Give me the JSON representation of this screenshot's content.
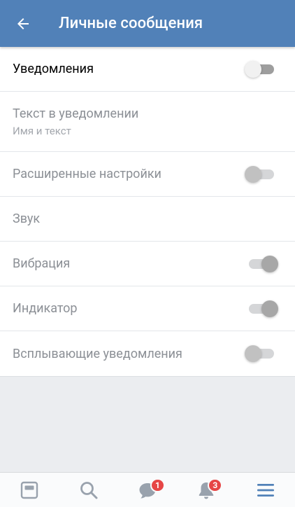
{
  "header": {
    "title": "Личные сообщения",
    "back_icon": "arrow-left-icon"
  },
  "settings": [
    {
      "label": "Уведомления",
      "sublabel": "",
      "toggle": "off",
      "enabled": true
    },
    {
      "label": "Текст в уведомлении",
      "sublabel": "Имя и текст",
      "toggle": null,
      "enabled": false
    },
    {
      "label": "Расширенные настройки",
      "sublabel": "",
      "toggle": "off",
      "enabled": false
    },
    {
      "label": "Звук",
      "sublabel": "",
      "toggle": null,
      "enabled": false
    },
    {
      "label": "Вибрация",
      "sublabel": "",
      "toggle": "on",
      "enabled": false
    },
    {
      "label": "Индикатор",
      "sublabel": "",
      "toggle": "on",
      "enabled": false
    },
    {
      "label": "Всплывающие уведомления",
      "sublabel": "",
      "toggle": "off",
      "enabled": false
    }
  ],
  "bottom_nav": {
    "items": [
      {
        "icon": "news-icon",
        "badge": ""
      },
      {
        "icon": "search-icon",
        "badge": ""
      },
      {
        "icon": "messages-icon",
        "badge": "1"
      },
      {
        "icon": "bell-icon",
        "badge": "3"
      },
      {
        "icon": "menu-icon",
        "badge": ""
      }
    ]
  },
  "colors": {
    "header": "#5181b8",
    "badge": "#e64646",
    "menu_active": "#5181b8"
  }
}
